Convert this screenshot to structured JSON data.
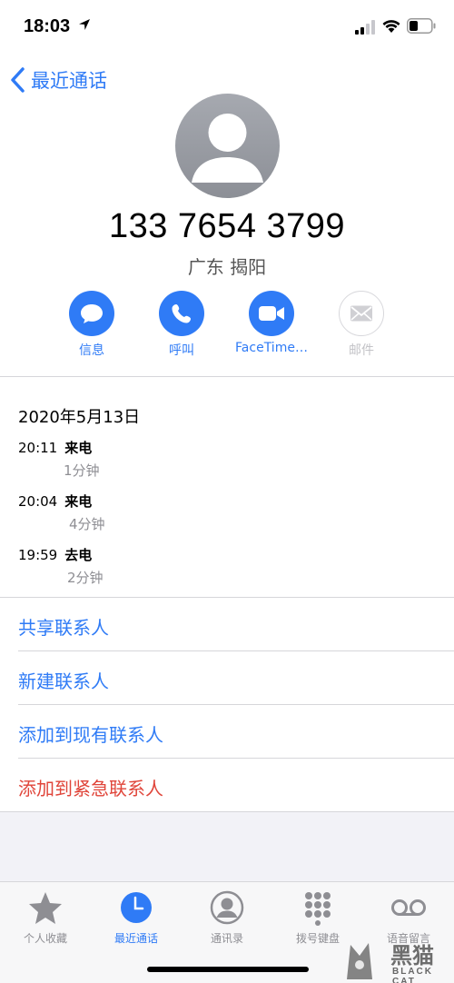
{
  "status_bar": {
    "time": "18:03"
  },
  "nav": {
    "back_label": "最近通话"
  },
  "contact": {
    "number": "133 7654 3799",
    "location": "广东 揭阳"
  },
  "actions": [
    {
      "label": "信息",
      "icon": "message-icon",
      "enabled": true
    },
    {
      "label": "呼叫",
      "icon": "phone-icon",
      "enabled": true
    },
    {
      "label": "FaceTime…",
      "icon": "video-icon",
      "enabled": true
    },
    {
      "label": "邮件",
      "icon": "mail-icon",
      "enabled": false
    }
  ],
  "call_history": {
    "date": "2020年5月13日",
    "entries": [
      {
        "time": "20:11",
        "type": "来电",
        "duration": "1分钟"
      },
      {
        "time": "20:04",
        "type": "来电",
        "duration": "4分钟"
      },
      {
        "time": "19:59",
        "type": "去电",
        "duration": "2分钟"
      }
    ]
  },
  "options": {
    "share": "共享联系人",
    "new_contact": "新建联系人",
    "add_existing": "添加到现有联系人",
    "add_emergency": "添加到紧急联系人"
  },
  "tabs": [
    {
      "label": "个人收藏",
      "icon": "star-icon",
      "active": false
    },
    {
      "label": "最近通话",
      "icon": "clock-icon",
      "active": true
    },
    {
      "label": "通讯录",
      "icon": "contacts-icon",
      "active": false
    },
    {
      "label": "拨号键盘",
      "icon": "keypad-icon",
      "active": false
    },
    {
      "label": "语音留言",
      "icon": "voicemail-icon",
      "active": false
    }
  ],
  "watermark": {
    "main": "黑猫",
    "sub": "BLACK CAT"
  },
  "colors": {
    "accent": "#2f7bf6",
    "destructive": "#e0453a",
    "secondary_text": "#8e8e93"
  }
}
